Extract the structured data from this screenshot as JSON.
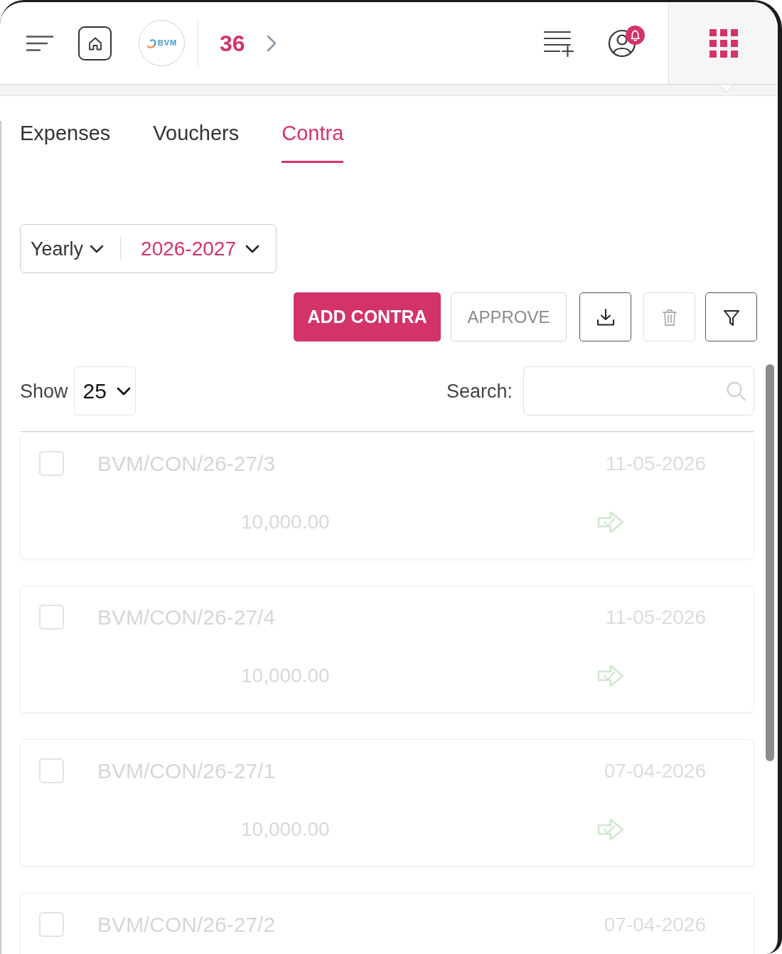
{
  "header": {
    "logo_text": "BVM",
    "count": "36"
  },
  "tabs": [
    {
      "label": "Expenses",
      "selected": false
    },
    {
      "label": "Vouchers",
      "selected": false
    },
    {
      "label": "Contra",
      "selected": true
    }
  ],
  "period": {
    "mode": "Yearly",
    "year": "2026-2027"
  },
  "actions": [
    {
      "kind": "primary",
      "label": "ADD CONTRA",
      "disabled": false
    },
    {
      "kind": "outline",
      "label": "APPROVE",
      "disabled": true
    },
    {
      "kind": "download",
      "disabled": false
    },
    {
      "kind": "delete",
      "disabled": true
    },
    {
      "kind": "filter",
      "disabled": false
    }
  ],
  "page_length": {
    "label": "Show",
    "value": "25"
  },
  "search": {
    "label": "Search:"
  },
  "rows": [
    {
      "checked": false,
      "reference": "BVM/CON/26-27/3",
      "date": "11-05-2026",
      "amount": "10,000.00"
    },
    {
      "checked": false,
      "reference": "BVM/CON/26-27/4",
      "date": "11-05-2026",
      "amount": "10,000.00"
    },
    {
      "checked": false,
      "reference": "BVM/CON/26-27/1",
      "date": "07-04-2026",
      "amount": "10,000.00"
    },
    {
      "checked": false,
      "reference": "BVM/CON/26-27/2",
      "date": "07-04-2026"
    }
  ]
}
